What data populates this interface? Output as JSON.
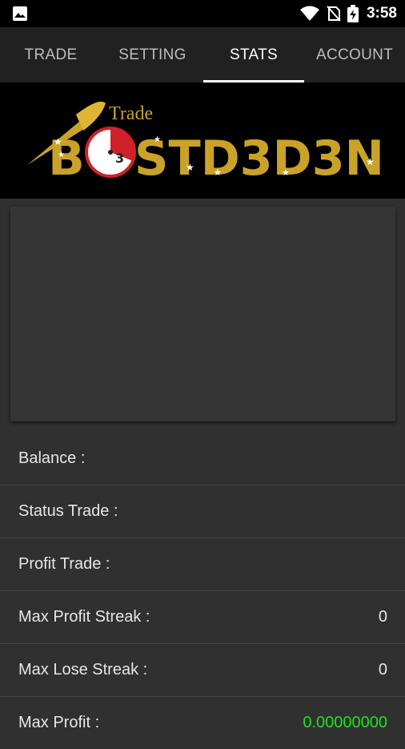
{
  "status_bar": {
    "time": "3:58",
    "icons": [
      "image-icon",
      "wifi-icon",
      "no-sim-icon",
      "battery-charging-icon"
    ]
  },
  "tabs": [
    {
      "label": "TRADE",
      "active": false
    },
    {
      "label": "SETTING",
      "active": false
    },
    {
      "label": "STATS",
      "active": true
    },
    {
      "label": "ACCOUNT",
      "active": false
    }
  ],
  "banner": {
    "logo_small_text": "Trade",
    "logo_text": "BOSTD3D3N",
    "logo_part_left": "B",
    "logo_part_right": "STD3D3N",
    "timer_digit": "3",
    "colors": {
      "gold": "#c9a227",
      "red": "#d0202a",
      "background": "#000000"
    }
  },
  "stats": [
    {
      "label": "Balance :",
      "value": ""
    },
    {
      "label": "Status Trade :",
      "value": ""
    },
    {
      "label": "Profit Trade :",
      "value": ""
    },
    {
      "label": "Max Profit Streak :",
      "value": "0"
    },
    {
      "label": "Max Lose Streak :",
      "value": "0"
    },
    {
      "label": "Max Profit :",
      "value": "0.00000000",
      "color": "#1de01d"
    }
  ]
}
